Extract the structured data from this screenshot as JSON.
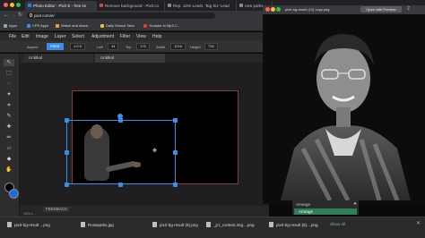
{
  "browser": {
    "tabs": [
      {
        "label": "Photo Editor : Pixlr E - free im",
        "favicon_color": "#2f80ed"
      },
      {
        "label": "Remove background - Pixlr.co",
        "favicon_color": "#d44"
      },
      {
        "label": "Rep. John Lewis, 'Big Six' Lead",
        "favicon_color": "#888"
      },
      {
        "label": "new parks",
        "favicon_color": "#888"
      }
    ],
    "url": "pixlr.com/e/",
    "bookmarks": [
      "Apps",
      "CPS Apps",
      "Watch and share...",
      "Daily School Tabs",
      "Youtube to Mp3 C..."
    ]
  },
  "editor": {
    "menu": [
      "File",
      "Edit",
      "Image",
      "Layer",
      "Select",
      "Adjustment",
      "Filter",
      "View",
      "Help"
    ],
    "options": {
      "aspect_label": "Aspect",
      "aspect_value": "FREE",
      "ratio_value": "1:0.5",
      "left_label": "Left",
      "left_value": "44",
      "top_label": "Top",
      "top_value": "175",
      "width_label": "Width",
      "width_value": "1216",
      "height_label": "Height",
      "height_value": "735"
    },
    "doc_tabs": [
      "Untitled",
      "Untitled"
    ],
    "feedback_label": "FEEDBACK",
    "status": "1920 x ..."
  },
  "preview_window": {
    "title": "pixlr-bg-result (10) copy.png",
    "open_button": "Open with Preview",
    "arrange_items": [
      "Arrange",
      "Arrange"
    ]
  },
  "downloads": {
    "items": [
      {
        "name": "pixlr-bg-result ...png"
      },
      {
        "name": "Roseparks.jpg"
      },
      {
        "name": "pixlr-bg-result (9).png"
      },
      {
        "name": "_jcr_content.img....png"
      },
      {
        "name": "pixlr-bg-result (8)....png"
      }
    ],
    "show_all": "Show All"
  },
  "colors": {
    "selection": "#3b8ee8",
    "foreground_swatch": "#000000",
    "background_swatch": "#1e6be0"
  }
}
